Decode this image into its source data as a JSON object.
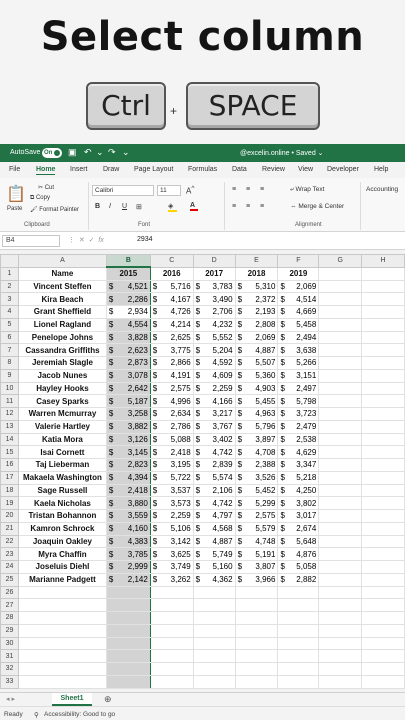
{
  "hero": {
    "title": "Select column",
    "key1": "Ctrl",
    "plus": "+",
    "key2": "SPACE"
  },
  "titlebar": {
    "autosave": "AutoSave",
    "toggle": "On",
    "document": "@excelin.online • Saved ⌄",
    "accent": "#217346"
  },
  "menu": [
    "File",
    "Home",
    "Insert",
    "Draw",
    "Page Layout",
    "Formulas",
    "Data",
    "Review",
    "View",
    "Developer",
    "Help"
  ],
  "ribbon": {
    "paste": "Paste",
    "cut": "Cut",
    "copy": "Copy",
    "format_painter": "Format Painter",
    "clipboard": "Clipboard",
    "font_name": "Calibri",
    "font_size": "11",
    "font": "Font",
    "bold": "B",
    "italic": "I",
    "underline": "U",
    "wrap_text": "Wrap Text",
    "merge_center": "Merge & Center",
    "alignment": "Alignment",
    "number_format": "Accounting"
  },
  "formula_bar": {
    "cell_ref": "B4",
    "fx": "fx",
    "value": "2934"
  },
  "columns": [
    "A",
    "B",
    "C",
    "D",
    "E",
    "F",
    "G",
    "H"
  ],
  "header_row": [
    "Name",
    "2015",
    "2016",
    "2017",
    "2018",
    "2019"
  ],
  "rows": [
    [
      "Vincent Steffen",
      "4,521",
      "5,716",
      "3,783",
      "5,310",
      "2,069"
    ],
    [
      "Kira Beach",
      "2,286",
      "4,167",
      "3,490",
      "2,372",
      "4,514"
    ],
    [
      "Grant Sheffield",
      "2,934",
      "4,726",
      "2,706",
      "2,193",
      "4,669"
    ],
    [
      "Lionel Ragland",
      "4,554",
      "4,214",
      "4,232",
      "2,808",
      "5,458"
    ],
    [
      "Penelope Johns",
      "3,828",
      "2,625",
      "5,552",
      "2,069",
      "2,494"
    ],
    [
      "Cassandra Griffiths",
      "2,623",
      "3,775",
      "5,204",
      "4,887",
      "3,638"
    ],
    [
      "Jeremiah Slagle",
      "2,873",
      "2,866",
      "4,592",
      "5,507",
      "5,266"
    ],
    [
      "Jacob Nunes",
      "3,078",
      "4,191",
      "4,609",
      "5,360",
      "3,151"
    ],
    [
      "Hayley Hooks",
      "2,642",
      "2,575",
      "2,259",
      "4,903",
      "2,497"
    ],
    [
      "Casey Sparks",
      "5,187",
      "4,996",
      "4,166",
      "5,455",
      "5,798"
    ],
    [
      "Warren Mcmurray",
      "3,258",
      "2,634",
      "3,217",
      "4,963",
      "3,723"
    ],
    [
      "Valerie Hartley",
      "3,882",
      "2,786",
      "3,767",
      "5,796",
      "2,479"
    ],
    [
      "Katia Mora",
      "3,126",
      "5,088",
      "3,402",
      "3,897",
      "2,538"
    ],
    [
      "Isai Cornett",
      "3,145",
      "2,418",
      "4,742",
      "4,708",
      "4,629"
    ],
    [
      "Taj Lieberman",
      "2,823",
      "3,195",
      "2,839",
      "2,388",
      "3,347"
    ],
    [
      "Makaela Washington",
      "4,394",
      "5,722",
      "5,574",
      "3,526",
      "5,218"
    ],
    [
      "Sage Russell",
      "2,418",
      "3,537",
      "2,106",
      "5,452",
      "4,250"
    ],
    [
      "Kaela Nicholas",
      "3,880",
      "3,573",
      "4,742",
      "5,299",
      "3,802"
    ],
    [
      "Tristan Bohannon",
      "3,559",
      "2,259",
      "4,797",
      "2,575",
      "3,017"
    ],
    [
      "Kamron Schrock",
      "4,160",
      "5,106",
      "4,568",
      "5,579",
      "2,674"
    ],
    [
      "Joaquin Oakley",
      "4,383",
      "3,142",
      "4,887",
      "4,748",
      "5,648"
    ],
    [
      "Myra Chaffin",
      "3,785",
      "3,625",
      "5,749",
      "5,191",
      "4,876"
    ],
    [
      "Joseluis Diehl",
      "2,999",
      "3,749",
      "5,160",
      "3,807",
      "5,058"
    ],
    [
      "Marianne Padgett",
      "2,142",
      "3,262",
      "4,362",
      "3,966",
      "2,882"
    ]
  ],
  "currency": "$",
  "row_numbers": [
    "1",
    "2",
    "3",
    "4",
    "5",
    "6",
    "7",
    "8",
    "9",
    "10",
    "11",
    "12",
    "13",
    "14",
    "15",
    "16",
    "17",
    "18",
    "19",
    "20",
    "21",
    "22",
    "23",
    "24",
    "25",
    "26",
    "27",
    "28",
    "29",
    "30",
    "31",
    "32",
    "33"
  ],
  "sheet_tab": "Sheet1",
  "add_sheet": "⊕",
  "status": {
    "ready": "Ready",
    "accessibility": "Accessibility: Good to go"
  }
}
